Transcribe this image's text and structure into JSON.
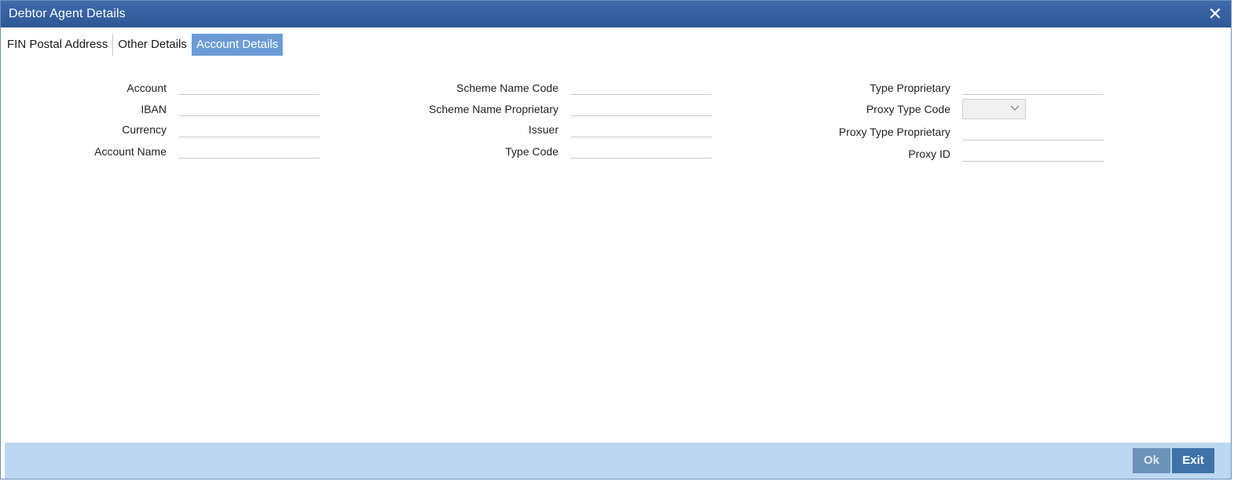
{
  "window": {
    "title": "Debtor Agent Details",
    "close_label": "✕"
  },
  "tabs": [
    {
      "label": "FIN Postal Address",
      "active": false
    },
    {
      "label": "Other Details",
      "active": false
    },
    {
      "label": "Account Details",
      "active": true
    }
  ],
  "column1": {
    "account": {
      "label": "Account",
      "value": ""
    },
    "iban": {
      "label": "IBAN",
      "value": ""
    },
    "currency": {
      "label": "Currency",
      "value": ""
    },
    "account_name": {
      "label": "Account Name",
      "value": ""
    }
  },
  "column2": {
    "scheme_name_code": {
      "label": "Scheme Name Code",
      "value": ""
    },
    "scheme_name_proprietary": {
      "label": "Scheme Name Proprietary",
      "value": ""
    },
    "issuer": {
      "label": "Issuer",
      "value": ""
    },
    "type_code": {
      "label": "Type Code",
      "value": ""
    }
  },
  "column3": {
    "type_proprietary": {
      "label": "Type Proprietary",
      "value": ""
    },
    "proxy_type_code": {
      "label": "Proxy Type Code",
      "value": ""
    },
    "proxy_type_proprietary": {
      "label": "Proxy Type Proprietary",
      "value": ""
    },
    "proxy_id": {
      "label": "Proxy ID",
      "value": ""
    }
  },
  "footer": {
    "ok_label": "Ok",
    "exit_label": "Exit"
  },
  "colors": {
    "titlebar": "#2d5797",
    "active_tab": "#6c9cd6",
    "footer": "#bcd7ef",
    "exit_button": "#3f73a8"
  },
  "icons": {
    "close": "close-icon",
    "dropdown": "chevron-down-icon"
  }
}
